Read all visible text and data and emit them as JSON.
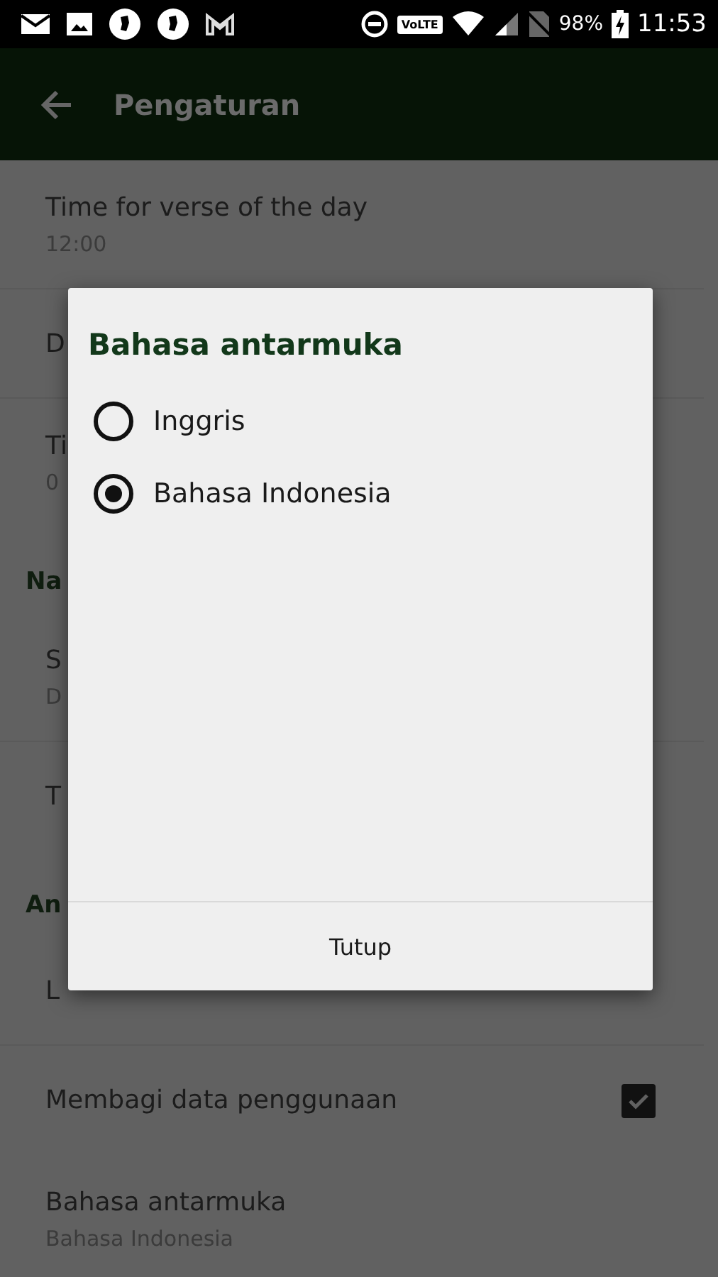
{
  "status_bar": {
    "network_badge": "VoLTE",
    "battery": "98%",
    "time": "11:53"
  },
  "app_bar": {
    "title": "Pengaturan"
  },
  "settings": [
    {
      "kind": "item",
      "title": "Time for verse of the day",
      "summary": "12:00"
    },
    {
      "kind": "item",
      "title": "D"
    },
    {
      "kind": "item",
      "title": "Ti",
      "summary": "0"
    },
    {
      "kind": "section",
      "title": "Na"
    },
    {
      "kind": "item",
      "title": "S",
      "summary": "D"
    },
    {
      "kind": "item",
      "title": "T"
    },
    {
      "kind": "section",
      "title": "An"
    },
    {
      "kind": "item",
      "title": "L"
    },
    {
      "kind": "checkbox",
      "title": "Membagi data penggunaan",
      "checked": true
    },
    {
      "kind": "item",
      "title": "Bahasa antarmuka",
      "summary": "Bahasa Indonesia"
    }
  ],
  "dialog": {
    "title": "Bahasa antarmuka",
    "options": [
      {
        "label": "Inggris",
        "selected": false
      },
      {
        "label": "Bahasa Indonesia",
        "selected": true
      }
    ],
    "button": "Tutup"
  }
}
